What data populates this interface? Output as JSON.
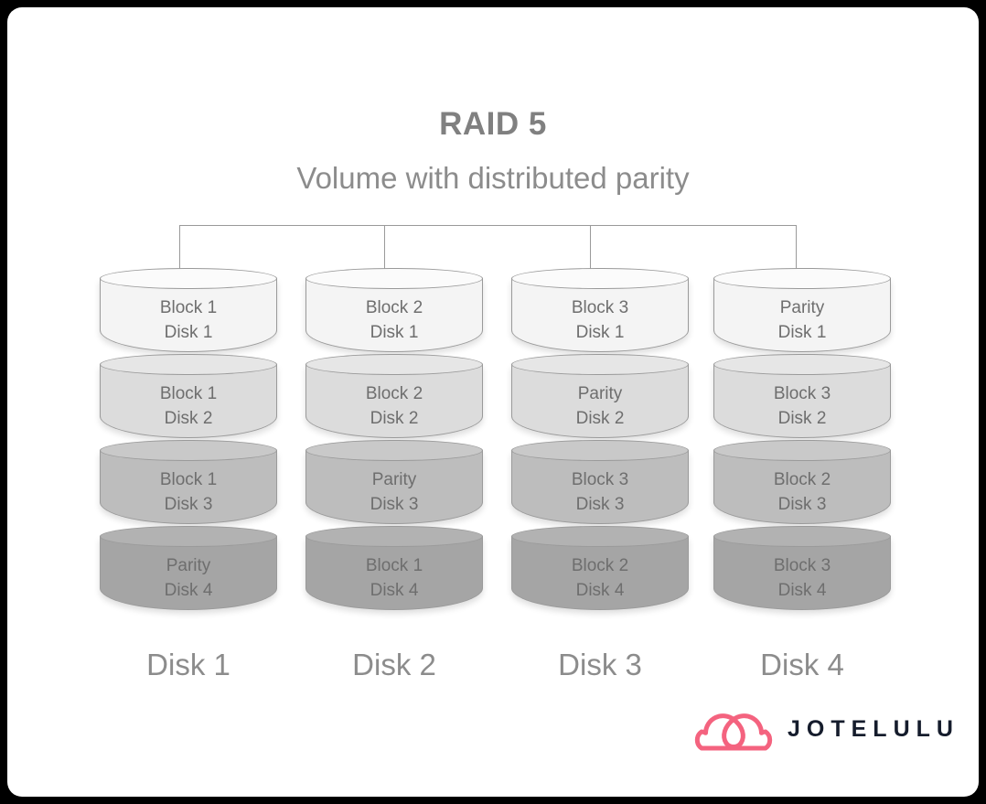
{
  "diagram": {
    "title": "RAID 5",
    "subtitle": "Volume with distributed parity",
    "tier_colors": [
      "#f4f4f4",
      "#dcdcdc",
      "#bdbdbd",
      "#a5a5a5"
    ],
    "tier_cap_colors": [
      "#fbfbfb",
      "#e6e6e6",
      "#c9c9c9",
      "#b2b2b2"
    ],
    "border_color": "#9a9a9a",
    "text_color": "#6e6e6e",
    "columns": [
      {
        "name": "Disk 1",
        "tiers": [
          {
            "block": "Block 1",
            "disk": "Disk 1",
            "label": "Block 1\nDisk 1"
          },
          {
            "block": "Block 1",
            "disk": "Disk 2",
            "label": "Block 1\nDisk 2"
          },
          {
            "block": "Block 1",
            "disk": "Disk 3",
            "label": "Block 1\nDisk 3"
          },
          {
            "block": "Parity",
            "disk": "Disk 4",
            "label": "Parity\nDisk 4"
          }
        ]
      },
      {
        "name": "Disk 2",
        "tiers": [
          {
            "block": "Block 2",
            "disk": "Disk 1",
            "label": "Block 2\nDisk 1"
          },
          {
            "block": "Block 2",
            "disk": "Disk 2",
            "label": "Block 2\nDisk 2"
          },
          {
            "block": "Parity",
            "disk": "Disk 3",
            "label": "Parity\nDisk 3"
          },
          {
            "block": "Block 1",
            "disk": "Disk 4",
            "label": "Block 1\nDisk 4"
          }
        ]
      },
      {
        "name": "Disk 3",
        "tiers": [
          {
            "block": "Block 3",
            "disk": "Disk 1",
            "label": "Block 3\nDisk 1"
          },
          {
            "block": "Parity",
            "disk": "Disk 2",
            "label": "Parity\nDisk 2"
          },
          {
            "block": "Block 3",
            "disk": "Disk 3",
            "label": "Block 3\nDisk 3"
          },
          {
            "block": "Block 2",
            "disk": "Disk 4",
            "label": "Block 2\nDisk 4"
          }
        ]
      },
      {
        "name": "Disk 4",
        "tiers": [
          {
            "block": "Parity",
            "disk": "Disk 1",
            "label": "Parity\nDisk 1"
          },
          {
            "block": "Block 3",
            "disk": "Disk 2",
            "label": "Block 3\nDisk 2"
          },
          {
            "block": "Block 2",
            "disk": "Disk 3",
            "label": "Block 2\nDisk 3"
          },
          {
            "block": "Block 3",
            "disk": "Disk 4",
            "label": "Block 3\nDisk 4"
          }
        ]
      }
    ]
  },
  "logo": {
    "wordmark": "JOTELULU",
    "mark_icon": "cloud-icon",
    "mark_color": "#f4637f",
    "word_color": "#151c2c"
  }
}
